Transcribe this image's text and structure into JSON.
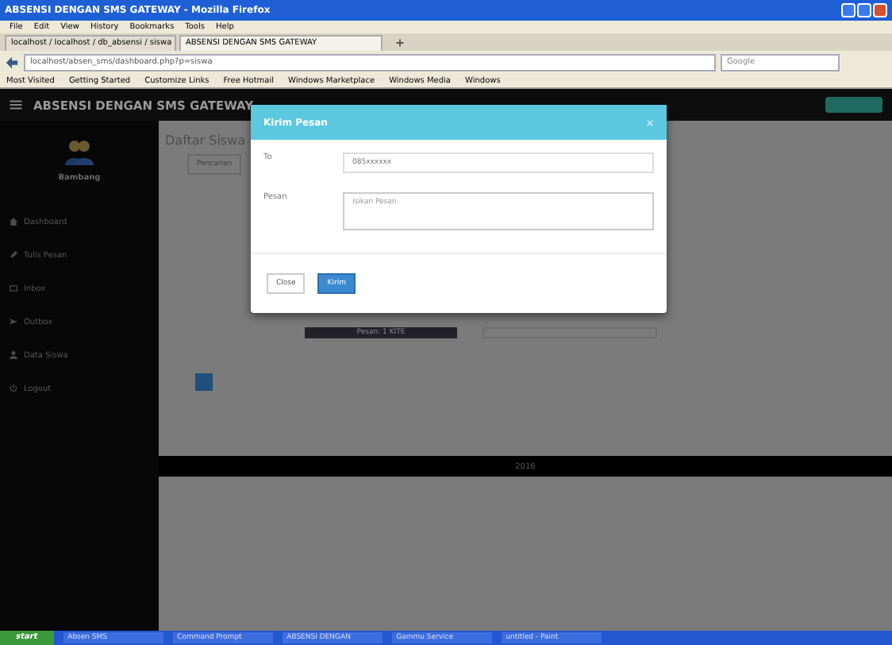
{
  "window": {
    "title": "ABSENSI DENGAN SMS GATEWAY - Mozilla Firefox"
  },
  "menu": [
    "File",
    "Edit",
    "View",
    "History",
    "Bookmarks",
    "Tools",
    "Help"
  ],
  "tabs": [
    {
      "label": "localhost / localhost / db_absensi / siswa",
      "selected": false
    },
    {
      "label": "ABSENSI DENGAN SMS GATEWAY",
      "selected": true
    }
  ],
  "address": {
    "value": "localhost/absen_sms/dashboard.php?p=siswa"
  },
  "search": {
    "placeholder": "Google"
  },
  "bookmarks": [
    "Most Visited",
    "Getting Started",
    "Customize Links",
    "Free Hotmail",
    "Windows Marketplace",
    "Windows Media",
    "Windows"
  ],
  "app": {
    "brand": "ABSENSI DENGAN SMS GATEWAY",
    "user": "Bambang",
    "sidebar": [
      {
        "label": "Dashboard"
      },
      {
        "label": "Tulis Pesan"
      },
      {
        "label": "Inbox"
      },
      {
        "label": "Outbox"
      },
      {
        "label": "Data Siswa"
      },
      {
        "label": "Logout"
      }
    ],
    "heading": "Daftar Siswa",
    "search_button": "Pencarian",
    "status_text": "Pesan: 1 KITE",
    "footer": "2016"
  },
  "modal": {
    "title": "Kirim Pesan",
    "to_label": "To",
    "to_value": "085xxxxxx",
    "message_label": "Pesan",
    "message_placeholder": "Isikan Pesan",
    "buttons": [
      {
        "label": "Close",
        "kind": "default"
      },
      {
        "label": "Kirim",
        "kind": "primary"
      }
    ]
  },
  "taskbar": {
    "start": "start",
    "tasks": [
      "Absen SMS",
      "Command Prompt",
      "ABSENSI DENGAN",
      "Gammu Service",
      "untitled - Paint"
    ]
  }
}
